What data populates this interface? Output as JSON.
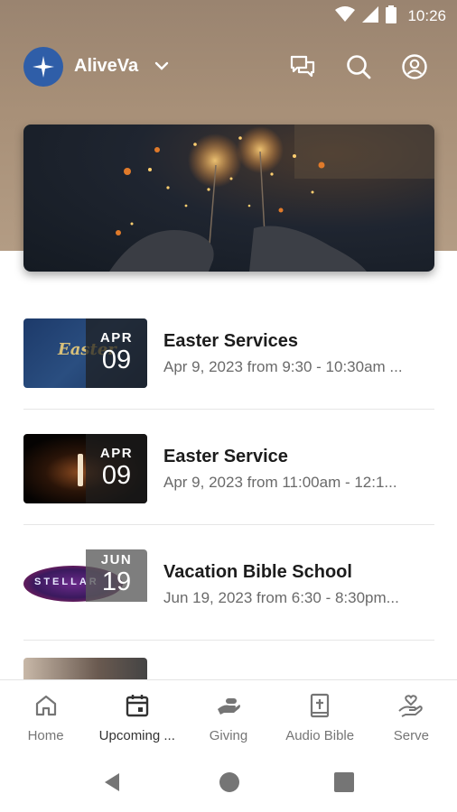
{
  "status_bar": {
    "time": "10:26"
  },
  "app_bar": {
    "org_name": "AliveVa"
  },
  "events": [
    {
      "title": "Easter Services",
      "subtitle": "Apr 9, 2023 from 9:30 - 10:30am ...",
      "month": "APR",
      "day": "09",
      "thumb_text": "Easter"
    },
    {
      "title": "Easter Service",
      "subtitle": "Apr 9, 2023 from 11:00am - 12:1...",
      "month": "APR",
      "day": "09",
      "thumb_text": ""
    },
    {
      "title": "Vacation Bible School",
      "subtitle": "Jun 19, 2023 from 6:30 - 8:30pm...",
      "month": "JUN",
      "day": "19",
      "thumb_text": "STELLAR"
    }
  ],
  "bottom_nav": [
    {
      "label": "Home",
      "icon": "home-icon"
    },
    {
      "label": "Upcoming ...",
      "icon": "calendar-icon",
      "active": true
    },
    {
      "label": "Giving",
      "icon": "giving-hand-icon"
    },
    {
      "label": "Audio Bible",
      "icon": "bible-icon"
    },
    {
      "label": "Serve",
      "icon": "heart-hand-icon"
    }
  ],
  "colors": {
    "header": "#a89078",
    "logo": "#2f5ea8",
    "divider": "#e6e6e6"
  }
}
